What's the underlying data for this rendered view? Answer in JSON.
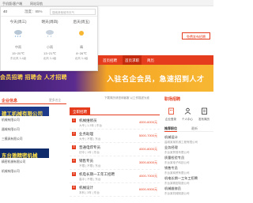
{
  "topbar": {
    "links": [
      "手机版/客户端",
      "网站导航"
    ]
  },
  "weather": {
    "location": "40",
    "humidity_label": "湿度：85%",
    "search_placeholder": "搜索其他城市天气",
    "days": [
      {
        "name": "今天(周三)",
        "cond": "中雨",
        "temp": "15~20℃",
        "wind": "东北风 3-4级"
      },
      {
        "name": "明天(周四)",
        "cond": "小雨",
        "temp": "13~21℃",
        "wind": "北风 3-4级"
      },
      {
        "name": "后天(周五)",
        "cond": "晴",
        "temp": "8~26℃",
        "wind": "北风 3-4级"
      }
    ]
  },
  "header": {
    "post_button": "免费发布招聘"
  },
  "nav": {
    "items": [
      "首页",
      "招聘",
      "求职",
      "培训",
      "企业",
      "资讯",
      "简历",
      "首页招聘",
      "首页求职",
      "简历",
      "客服"
    ],
    "active_index": 6
  },
  "banner": {
    "left_text": "会员招聘 招聘会 人才招聘",
    "right_text": "入驻名企会员，急速招到人才"
  },
  "companies": {
    "title": "企业信息",
    "more": "更多名企",
    "ads": [
      "建工机械有限公司",
      "东台雅精密机械"
    ],
    "lines": [
      "机械有限公司",
      "器械有限公司",
      "三模具有限公司",
      "精密机械有限公司",
      "机械有限公司"
    ]
  },
  "jobs": {
    "notice": "下载简历请咨询客服 以工作描述为准",
    "tab": "全职招聘",
    "list": [
      {
        "title": "机械维修员",
        "sub": "大专 | 1-3年 | 东台",
        "salary": "4000-6000元"
      },
      {
        "title": "业务助理",
        "sub": "大专 | 不限 | 东台",
        "salary": "5000-7000元"
      },
      {
        "title": "普通电焊专员",
        "sub": "初中 | 1年 | 东台",
        "salary": "4000-8000元"
      },
      {
        "title": "销售专员",
        "sub": "不限 | 不限 | 东台",
        "salary": "3000-6000元"
      },
      {
        "title": "机电长期一工年工招聘",
        "sub": "高中 | 不限 | 东台",
        "salary": "4000-7000元"
      },
      {
        "title": "机械设计",
        "sub": "本科 | 3年 | 东台",
        "salary": "6000-9000元"
      }
    ]
  },
  "right": {
    "title": "职场招聘",
    "icons": [
      {
        "label": "企业登录"
      },
      {
        "label": "个人中心"
      },
      {
        "label": "发布简历"
      }
    ],
    "tabs": [
      "推荐职位",
      "最新"
    ],
    "jobs": [
      {
        "a": "机械设计",
        "b": "盐城某某机械工程有限公司"
      },
      {
        "a": "业务经理",
        "b": "东台某贸易有限公司"
      },
      {
        "a": "质量检验专员",
        "b": "东台某电子科技公司"
      },
      {
        "a": "销售专员",
        "b": "东台某商贸有限公司"
      },
      {
        "a": "机电长期一工年工招聘",
        "b": "东台某精密制造公司"
      },
      {
        "a": "机械维修员",
        "b": "东台某机械制造公司"
      }
    ]
  },
  "colors": {
    "brand": "#e63c1e",
    "banner_dark": "#3a1d6e",
    "banner_gold": "#f7b733",
    "ad_blue": "#1e3a8a"
  }
}
